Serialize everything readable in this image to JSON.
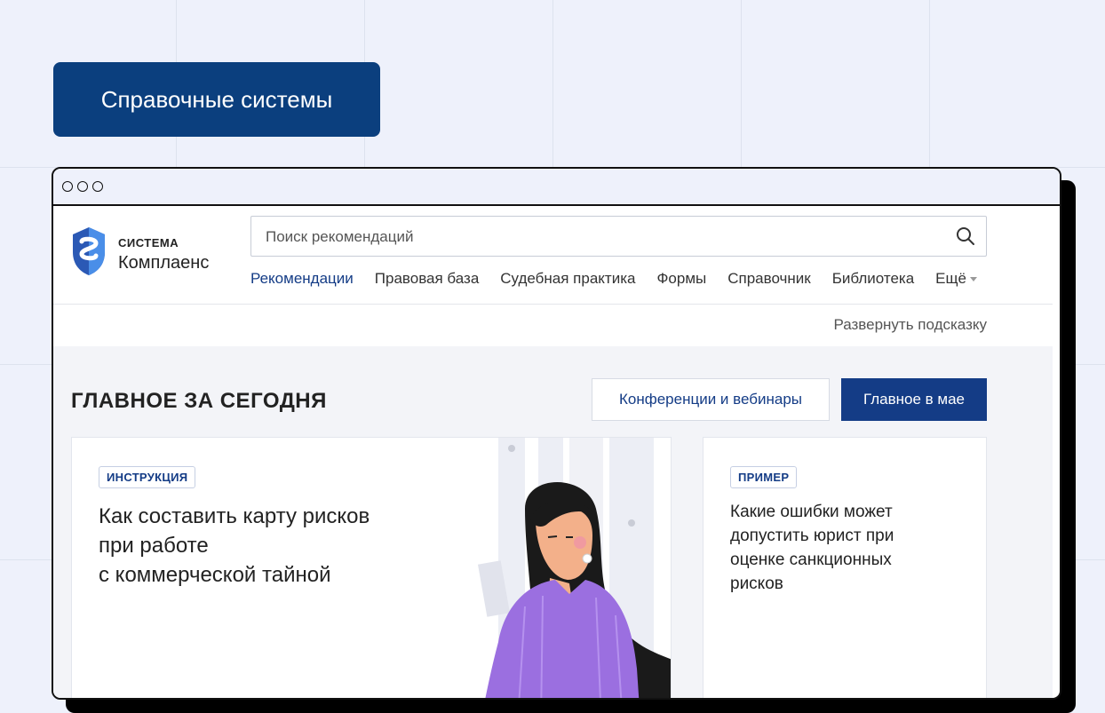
{
  "page_badge": "Справочные системы",
  "window": {
    "controls": [
      "circle-1",
      "circle-2",
      "circle-3"
    ]
  },
  "header": {
    "logo_top": "СИСТЕМА",
    "logo_bottom": "Комплаенс",
    "search": {
      "placeholder": "Поиск рекомендаций",
      "value": ""
    },
    "nav": [
      {
        "label": "Рекомендации",
        "active": true
      },
      {
        "label": "Правовая база"
      },
      {
        "label": "Судебная практика"
      },
      {
        "label": "Формы"
      },
      {
        "label": "Справочник"
      },
      {
        "label": "Библиотека"
      },
      {
        "label": "Ещё"
      }
    ],
    "hint_link": "Развернуть подсказку"
  },
  "main": {
    "section_title": "ГЛАВНОЕ ЗА СЕГОДНЯ",
    "buttons": {
      "secondary": "Конференции и вебинары",
      "primary": "Главное в мае"
    },
    "cards": [
      {
        "tag": "ИНСТРУКЦИЯ",
        "title_lines": [
          "Как составить карту рисков",
          "при работе",
          "с коммерческой тайной"
        ]
      },
      {
        "tag": "ПРИМЕР",
        "title_lines": [
          "Какие ошибки может",
          "допустить юрист при",
          "оценке санкционных",
          "рисков"
        ]
      }
    ]
  },
  "colors": {
    "brand_dark": "#0b3f7e",
    "accent": "#143c86",
    "background": "#eef1fb",
    "illustration_purple": "#9b6fe0"
  }
}
